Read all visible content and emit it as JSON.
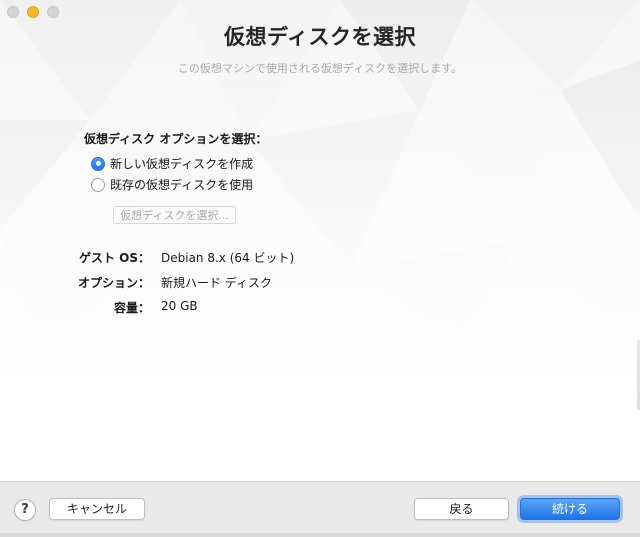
{
  "window": {
    "title": "仮想ディスクを選択",
    "subtitle": "この仮想マシンで使用される仮想ディスクを選択します。"
  },
  "disk_options": {
    "label": "仮想ディスク オプションを選択：",
    "options": [
      {
        "label": "新しい仮想ディスクを作成",
        "selected": true
      },
      {
        "label": "既存の仮想ディスクを使用",
        "selected": false
      }
    ],
    "choose_button": "仮想ディスクを選択..."
  },
  "info": [
    {
      "key": "ゲスト OS：",
      "value": "Debian 8.x (64 ビット)"
    },
    {
      "key": "オプション：",
      "value": "新規ハード ディスク"
    },
    {
      "key": "容量：",
      "value": "20 GB"
    }
  ],
  "footer": {
    "help_label": "?",
    "cancel_label": "キャンセル",
    "back_label": "戻る",
    "continue_label": "続ける"
  },
  "colors": {
    "accent": "#1f73e6",
    "traffic_minimize": "#f7b731"
  }
}
